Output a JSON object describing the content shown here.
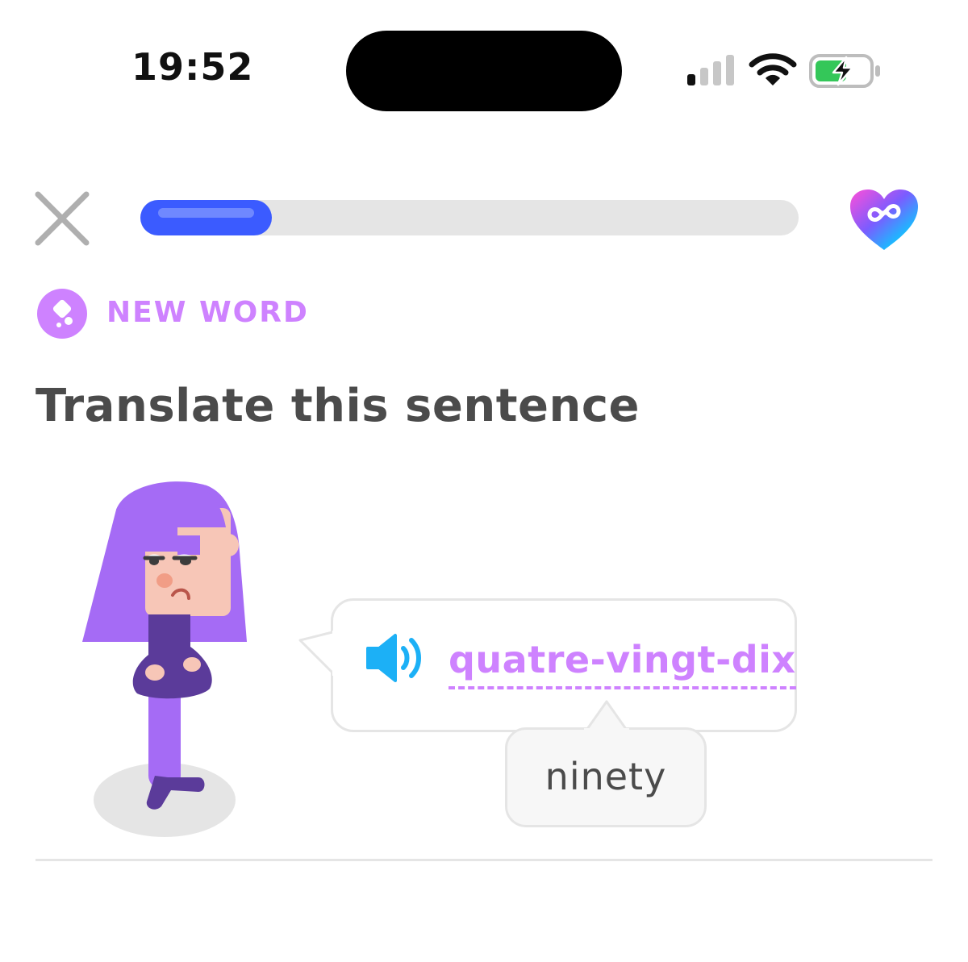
{
  "status_bar": {
    "time": "19:52",
    "signal_bars": 1,
    "battery_charging": true
  },
  "header": {
    "close_icon": "close-icon",
    "progress_fraction": 0.2,
    "hearts_icon": "infinity-heart-icon"
  },
  "lesson": {
    "badge_label": "NEW WORD",
    "prompt": "Translate this sentence",
    "foreign_word": "quatre-vingt-dix",
    "hint": "ninety"
  },
  "colors": {
    "accent_purple": "#ce82ff",
    "progress_blue": "#3b5bff",
    "speaker_blue": "#1cb0f6",
    "title_gray": "#4b4b4b"
  }
}
